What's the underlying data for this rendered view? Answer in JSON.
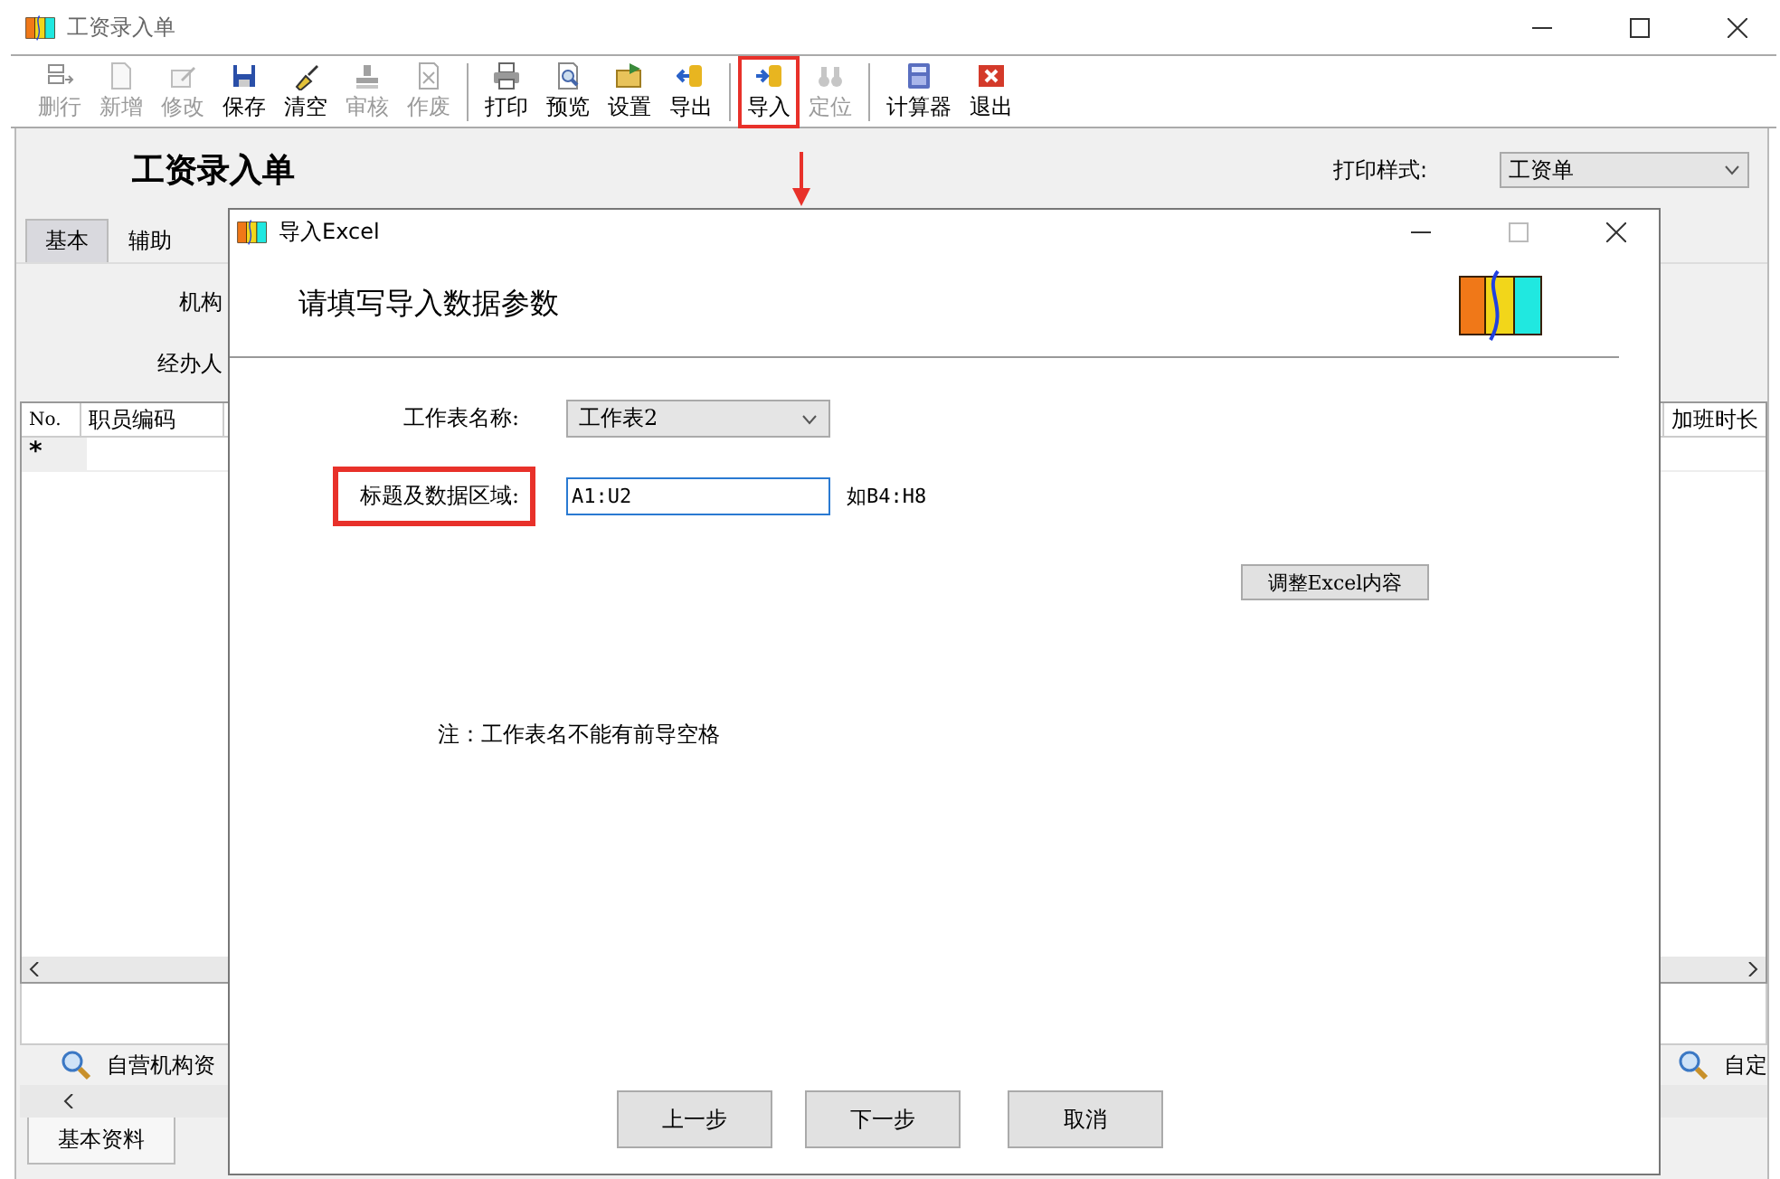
{
  "window": {
    "title": "工资录入单"
  },
  "toolbar": {
    "groups": [
      [
        {
          "label": "删行",
          "disabled": true,
          "highlighted": false
        },
        {
          "label": "新增",
          "disabled": true,
          "highlighted": false
        },
        {
          "label": "修改",
          "disabled": true,
          "highlighted": false
        },
        {
          "label": "保存",
          "disabled": false,
          "highlighted": false
        },
        {
          "label": "清空",
          "disabled": false,
          "highlighted": false
        },
        {
          "label": "审核",
          "disabled": true,
          "highlighted": false
        },
        {
          "label": "作废",
          "disabled": true,
          "highlighted": false
        }
      ],
      [
        {
          "label": "打印",
          "disabled": false,
          "highlighted": false
        },
        {
          "label": "预览",
          "disabled": false,
          "highlighted": false
        },
        {
          "label": "设置",
          "disabled": false,
          "highlighted": false
        },
        {
          "label": "导出",
          "disabled": false,
          "highlighted": false
        }
      ],
      [
        {
          "label": "导入",
          "disabled": false,
          "highlighted": true
        },
        {
          "label": "定位",
          "disabled": true,
          "highlighted": false
        }
      ],
      [
        {
          "label": "计算器",
          "disabled": false,
          "highlighted": false
        },
        {
          "label": "退出",
          "disabled": false,
          "highlighted": false
        }
      ]
    ]
  },
  "form": {
    "title": "工资录入单",
    "print_style": {
      "label": "打印样式:",
      "value": "工资单"
    },
    "tabs": [
      {
        "label": "基本",
        "selected": true
      },
      {
        "label": "辅助",
        "selected": false
      }
    ],
    "fields": [
      {
        "label": "机构"
      },
      {
        "label": "经办人"
      }
    ]
  },
  "grid": {
    "columns": [
      "No.",
      "职员编码",
      "加班时长"
    ],
    "rows": [
      {
        "marker": "*"
      }
    ]
  },
  "bottom_panel": {
    "links": [
      {
        "label": "自营机构资"
      },
      {
        "label": "自定"
      }
    ],
    "tabs": [
      {
        "label": "基本资料",
        "selected": true
      }
    ]
  },
  "dialog": {
    "title": "导入Excel",
    "heading": "请填写导入数据参数",
    "fields": [
      {
        "label": "工作表名称:",
        "kind": "select",
        "value": "工作表2",
        "highlighted": false
      },
      {
        "label": "标题及数据区域:",
        "kind": "input",
        "value": "A1:U2",
        "hint": "如B4:H8",
        "highlighted": true
      }
    ],
    "adjust_button": "调整Excel内容",
    "note": "注：工作表名不能有前导空格",
    "buttons": [
      "上一步",
      "下一步",
      "取消"
    ]
  }
}
